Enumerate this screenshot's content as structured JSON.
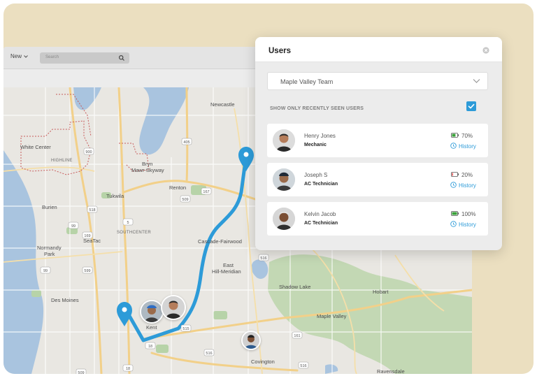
{
  "toolbar": {
    "new_label": "New",
    "search_placeholder": "Search"
  },
  "map": {
    "labels": {
      "newcastle": "Newcastle",
      "white_center": "White Center",
      "highline": "HIGHLINE",
      "bryn_mawr": "Bryn\nMawr-Skyway",
      "renton": "Renton",
      "tukwila": "Tukwila",
      "burien": "Burien",
      "southcenter": "SOUTHCENTER",
      "seatac": "SeaTac",
      "normandy_park": "Normandy\nPark",
      "cascade_fairwood": "Cascade-Fairwood",
      "east_hill": "East\nHill-Meridian",
      "shadow_lake": "Shadow Lake",
      "hobart": "Hobart",
      "des_moines": "Des Moines",
      "kent": "Kent",
      "maple_valley": "Maple Valley",
      "covington": "Covington",
      "ravensdale": "Ravensdale"
    },
    "shields": [
      "405",
      "900",
      "509",
      "518",
      "99",
      "5",
      "599",
      "167",
      "515",
      "169",
      "516",
      "18",
      "516",
      "509",
      "516",
      "18",
      "161",
      "99"
    ]
  },
  "panel": {
    "title": "Users",
    "team_select_value": "Maple Valley Team",
    "recent_label": "SHOW ONLY RECENTLY SEEN USERS",
    "recent_checked": true,
    "users": [
      {
        "name": "Henry Jones",
        "role": "Mechanic",
        "battery": "70%",
        "battery_level": 0.7,
        "battery_color": "#3aa23a",
        "history": "History"
      },
      {
        "name": "Joseph S",
        "role": "AC Technician",
        "battery": "20%",
        "battery_level": 0.2,
        "battery_color": "#e24b4b",
        "history": "History"
      },
      {
        "name": "Kelvin Jacob",
        "role": "AC Technician",
        "battery": "100%",
        "battery_level": 1.0,
        "battery_color": "#3aa23a",
        "history": "History"
      }
    ]
  },
  "colors": {
    "accent": "#2d9bd8",
    "route": "#2d9bd8",
    "water": "#a9c4df",
    "park": "#b7d3a8"
  }
}
